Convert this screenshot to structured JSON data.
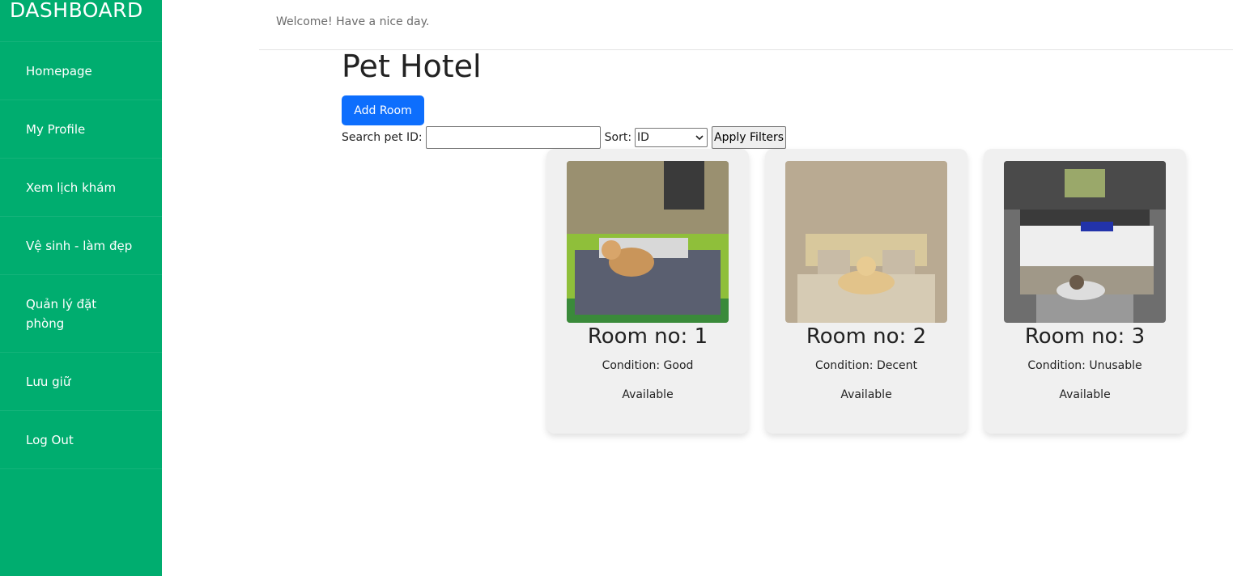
{
  "sidebar": {
    "brand": "DASHBOARD",
    "items": [
      {
        "label": "Homepage"
      },
      {
        "label": "My Profile"
      },
      {
        "label": "Xem lịch khám"
      },
      {
        "label": "Vệ sinh - làm đẹp"
      },
      {
        "label": "Quản lý đặt phòng"
      },
      {
        "label": "Lưu giữ"
      },
      {
        "label": "Log Out"
      }
    ]
  },
  "topbar": {
    "welcome": "Welcome! Have a nice day."
  },
  "main": {
    "title": "Pet Hotel",
    "add_button": "Add Room",
    "search_label": "Search pet ID:",
    "search_value": "",
    "sort_label": "Sort:",
    "sort_value": "ID",
    "apply_button": "Apply Filters"
  },
  "rooms": [
    {
      "title": "Room no: 1",
      "condition": "Condition: Good",
      "status": "Available"
    },
    {
      "title": "Room no: 2",
      "condition": "Condition: Decent",
      "status": "Available"
    },
    {
      "title": "Room no: 3",
      "condition": "Condition: Unusable",
      "status": "Available"
    }
  ],
  "colors": {
    "sidebar": "#00ad6f",
    "primary_button": "#0d6efd",
    "card_bg": "#f0f0f0"
  }
}
